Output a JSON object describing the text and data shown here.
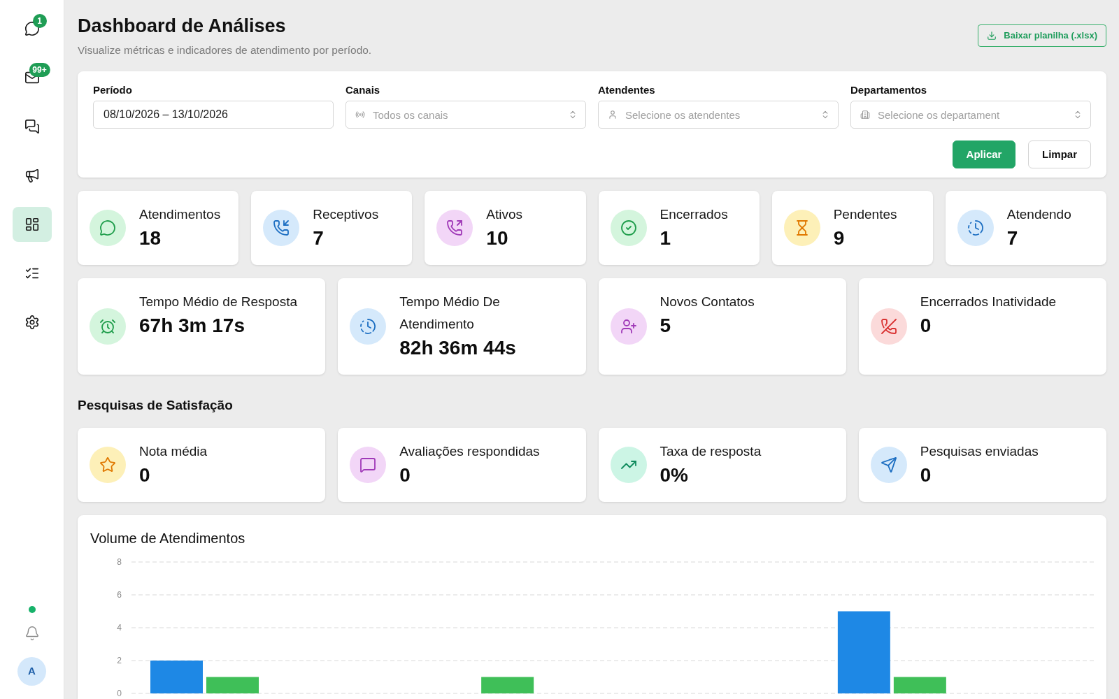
{
  "sidebar": {
    "items": [
      {
        "selected": false,
        "badge": "1"
      },
      {
        "selected": false,
        "badge": "99+"
      },
      {
        "selected": false
      },
      {
        "selected": false
      },
      {
        "selected": true
      },
      {
        "selected": false
      },
      {
        "selected": false
      }
    ],
    "online": true,
    "avatar": "A"
  },
  "header": {
    "title": "Dashboard de Análises",
    "subtitle": "Visualize métricas e indicadores de atendimento por período.",
    "export_button": "Baixar planilha (.xlsx)"
  },
  "filters": {
    "fields": [
      {
        "kind": "date",
        "label": "Período",
        "value": "08/10/2026 – 13/10/2026"
      },
      {
        "kind": "select",
        "label": "Canais",
        "placeholder": "Todos os canais"
      },
      {
        "kind": "select",
        "label": "Atendentes",
        "placeholder": "Selecione os atendentes"
      },
      {
        "kind": "select",
        "label": "Departamentos",
        "placeholder": "Selecione os departament"
      }
    ],
    "buttons": [
      {
        "kind": "primary",
        "label": "Aplicar"
      },
      {
        "kind": "secondary",
        "label": "Limpar"
      }
    ]
  },
  "stats": [
    {
      "label": "Atendimentos",
      "value": "18",
      "color": "#d4f5dd"
    },
    {
      "label": "Receptivos",
      "value": "7",
      "color": "#d5e9fb"
    },
    {
      "label": "Ativos",
      "value": "10",
      "color": "#f2d6f7"
    },
    {
      "label": "Encerrados",
      "value": "1",
      "color": "#d4f5dd"
    },
    {
      "label": "Pendentes",
      "value": "9",
      "color": "#fdf0b8"
    },
    {
      "label": "Atendendo",
      "value": "7",
      "color": "#d5e9fb"
    }
  ],
  "metrics": [
    {
      "label": "Tempo Médio de Resposta",
      "value": "67h 3m 17s",
      "color": "#d4f5dd"
    },
    {
      "label": "Tempo Médio De Atendimento",
      "value": "82h 36m 44s",
      "color": "#d5e9fb"
    },
    {
      "label": "Novos Contatos",
      "value": "5",
      "color": "#f2d6f7"
    },
    {
      "label": "Encerrados Inatividade",
      "value": "0",
      "color": "#fbdada"
    }
  ],
  "satisfaction": {
    "title": "Pesquisas de Satisfação",
    "cards": [
      {
        "label": "Nota média",
        "value": "0",
        "color": "#fdf0b8"
      },
      {
        "label": "Avaliações respondidas",
        "value": "0",
        "color": "#f2d6f7"
      },
      {
        "label": "Taxa de resposta",
        "value": "0%",
        "color": "#ccf5e5"
      },
      {
        "label": "Pesquisas enviadas",
        "value": "0",
        "color": "#d5e9fb"
      }
    ]
  },
  "volume_chart": {
    "chart_data": {
      "type": "bar",
      "title": "Volume de Atendimentos",
      "ylim": [
        0,
        8
      ],
      "yticks": [
        0,
        2,
        4,
        6,
        8
      ],
      "grid": true,
      "series": [
        {
          "color": "#1e88e5",
          "values": [
            2,
            0,
            0,
            0,
            0,
            5,
            0
          ]
        },
        {
          "color": "#3fbf58",
          "values": [
            1,
            0,
            1,
            0,
            0,
            1,
            0
          ]
        }
      ]
    }
  }
}
